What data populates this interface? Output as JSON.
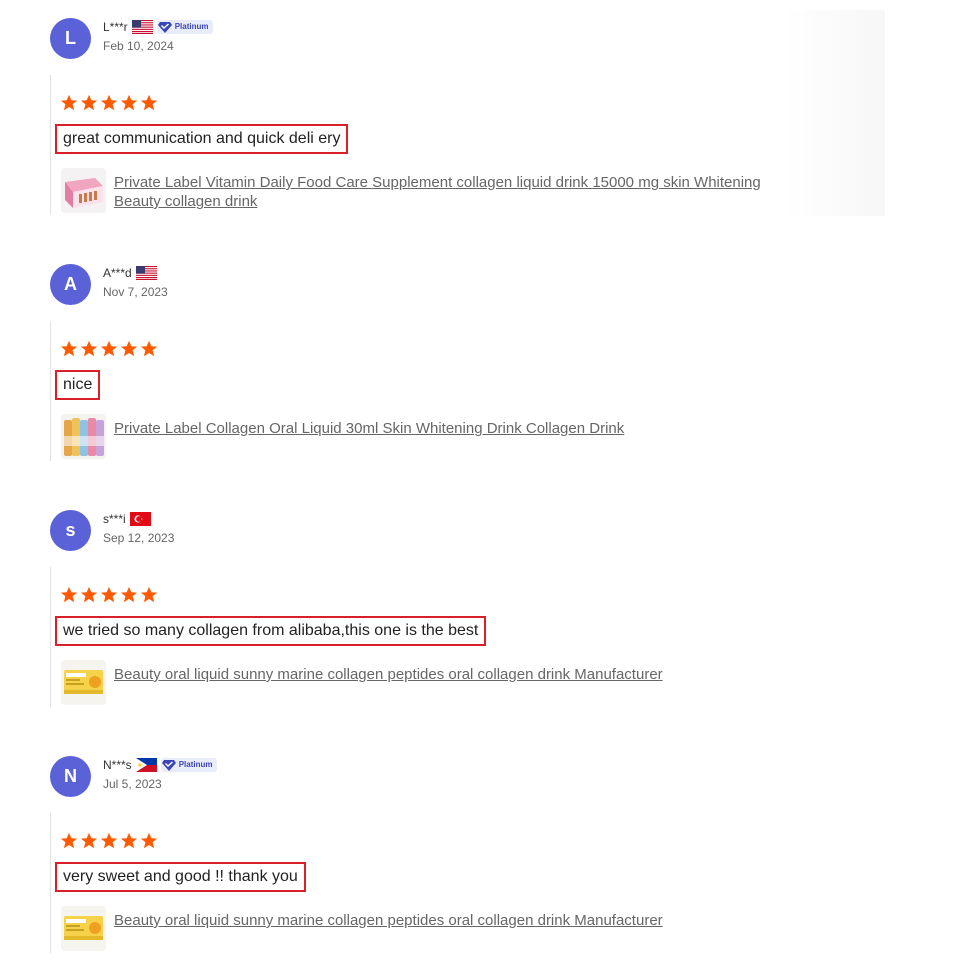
{
  "reviews": [
    {
      "initial": "L",
      "name": "L***r",
      "flag": "us-flag-icon",
      "badge": "Platinum",
      "date": "Feb 10, 2024",
      "rating": 5,
      "comment": "great communication and quick deli ery",
      "product": "Private Label Vitamin Daily Food Care Supplement collagen liquid drink 15000 mg skin Whitening Beauty collagen drink",
      "thumb": "vitamin-box-thumbnail"
    },
    {
      "initial": "A",
      "name": "A***d",
      "flag": "us-flag-icon",
      "date": "Nov 7, 2023",
      "rating": 5,
      "comment": "nice",
      "product": "Private Label Collagen Oral Liquid 30ml Skin Whitening Drink Collagen Drink",
      "thumb": "collagen-bottles-thumbnail"
    },
    {
      "initial": "s",
      "name": "s***i",
      "flag": "turkey-flag-icon",
      "date": "Sep 12, 2023",
      "rating": 5,
      "comment": "we tried so many collagen from alibaba,this one is the best",
      "product": "Beauty oral liquid sunny marine collagen peptides oral collagen drink Manufacturer",
      "thumb": "collagen-sachet-thumbnail"
    },
    {
      "initial": "N",
      "name": "N***s",
      "flag": "philippines-flag-icon",
      "badge": "Platinum",
      "date": "Jul 5, 2023",
      "rating": 5,
      "comment": "very sweet and good !! thank you",
      "product": "Beauty oral liquid sunny marine collagen peptides oral collagen drink Manufacturer",
      "thumb": "collagen-sachet-thumbnail"
    }
  ],
  "colors": {
    "avatar": "#5b61d6",
    "star": "#ff5a00",
    "highlight_border": "#d9202a",
    "badge_bg": "#e9ecfb",
    "badge_text": "#3a46b8"
  }
}
